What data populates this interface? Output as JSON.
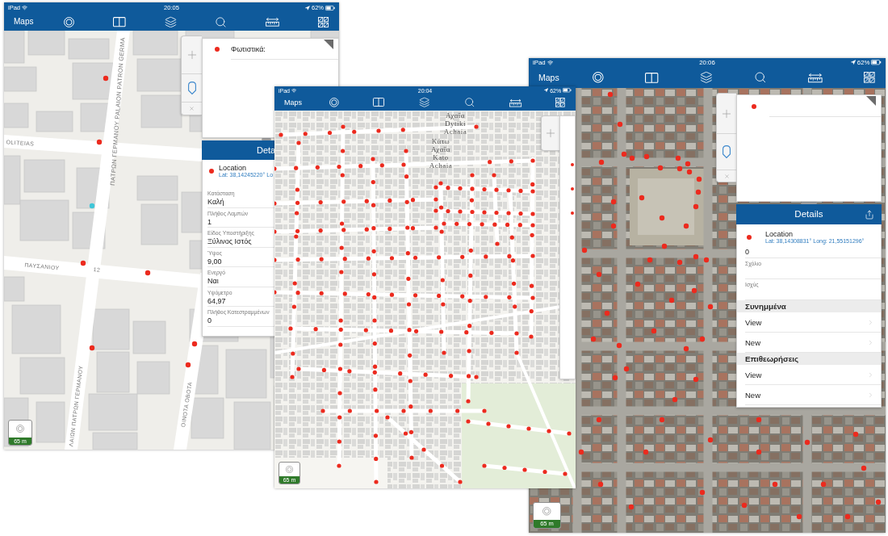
{
  "screens": [
    {
      "status_bar": {
        "device": "iPad",
        "time": "20:05",
        "battery": "62%"
      },
      "nav_bar": {
        "title": "Maps"
      },
      "map": {
        "kind": "streets",
        "selection": true,
        "labels": [
          "OLITEIAS",
          "ΠΑΤΡΩΝ ΓΕΡΜΑΝΟΥ PALAION PATRON GERMA",
          "ΠΑΥΣΑΝΙΟΥ",
          "12",
          "ΛΑΙΩΝ ΠΑΤΡΩΝ ΓΕΡΜΑΝΟΥ",
          "ΟΙΝΟΤΑ ΟΒΟΤΑ"
        ]
      },
      "popup": {
        "items": [
          {
            "marker": true,
            "label": "Φωτιστικά:"
          }
        ]
      },
      "details": {
        "title": "Deta",
        "location": {
          "title": "Location",
          "coordinates": "Lat: 38,14245220° Lo"
        },
        "fields": [
          {
            "label": "Κατάσταση",
            "value": "Καλή"
          },
          {
            "label": "Πλήθος Λαμπών",
            "value": "1"
          },
          {
            "label": "Είδος Υποστήριξης",
            "value": "Ξύλινος Ιστός"
          },
          {
            "label": "Ύψος",
            "value": "9,00"
          },
          {
            "label": "Ενεργό",
            "value": "Ναι"
          },
          {
            "label": "Υψόμετρο",
            "value": "64,97"
          },
          {
            "label": "Πλήθος Κατεστραμμένων",
            "value": "0"
          }
        ]
      },
      "scale": {
        "label": "65 m"
      }
    },
    {
      "status_bar": {
        "device": "iPad",
        "time": "20:04",
        "battery": "62%"
      },
      "nav_bar": {
        "title": "Maps"
      },
      "map": {
        "kind": "town",
        "labels": [
          "Αχαΐα\nDytiki\nAchaia",
          "Κάτω\nΑχαΐα\nKato\nAchaia"
        ]
      },
      "popup": {
        "items": [
          {
            "marker": true
          },
          {
            "marker": true
          },
          {
            "marker": true
          }
        ]
      },
      "scale": {
        "label": "65 m"
      }
    },
    {
      "status_bar": {
        "device": "iPad",
        "time": "20:06",
        "battery": "62%"
      },
      "nav_bar": {
        "title": "Maps"
      },
      "map": {
        "kind": "satellite"
      },
      "popup": {
        "items": [
          {
            "marker": true
          }
        ]
      },
      "details": {
        "title": "Details",
        "share": true,
        "location": {
          "title": "Location",
          "coordinates": "Lat: 38,14308831° Long: 21,55151296°"
        },
        "fields": [
          {
            "value": "0"
          },
          {
            "label": "Σχόλιο"
          },
          {
            "label": "Ισχύς"
          }
        ],
        "sections": [
          {
            "title": "Συνημμένα",
            "links": [
              "View",
              "New"
            ]
          },
          {
            "title": "Επιθεωρήσεις",
            "links": [
              "View",
              "New"
            ]
          }
        ]
      },
      "scale": {
        "label": "65 m"
      }
    }
  ]
}
